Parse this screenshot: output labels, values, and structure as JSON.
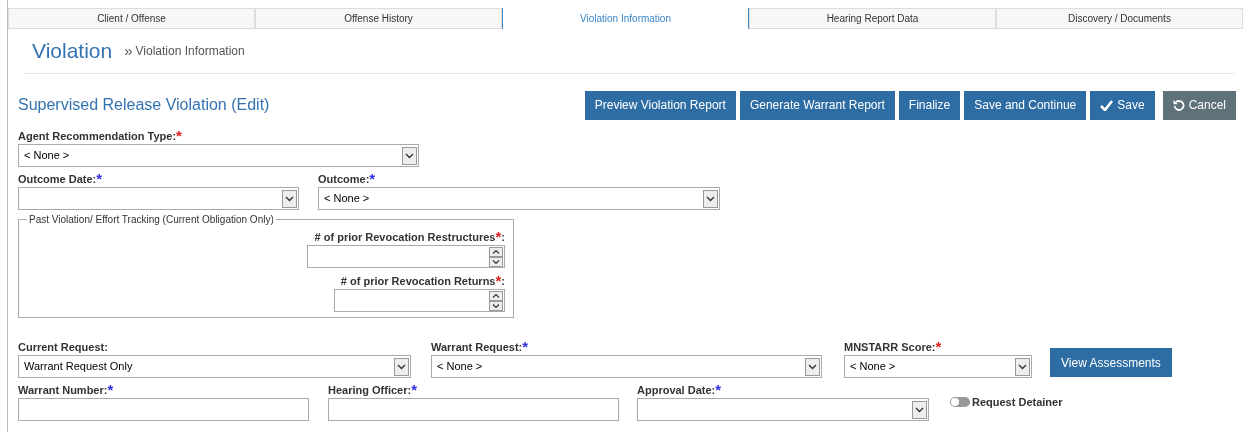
{
  "tabs": [
    {
      "label": "Client / Offense",
      "selected": false
    },
    {
      "label": "Offense History",
      "selected": false
    },
    {
      "label": "Violation Information",
      "selected": true
    },
    {
      "label": "Hearing Report Data",
      "selected": false
    },
    {
      "label": "Discovery / Documents",
      "selected": false
    }
  ],
  "header": {
    "title": "Violation",
    "breadcrumb_separator": "»",
    "breadcrumb": "Violation Information"
  },
  "form_title": "Supervised Release Violation (Edit)",
  "buttons": [
    {
      "label": "Preview Violation Report",
      "kind": "primary"
    },
    {
      "label": "Generate Warrant Report",
      "kind": "primary"
    },
    {
      "label": "Finalize",
      "kind": "primary"
    },
    {
      "label": "Save and Continue",
      "kind": "primary"
    },
    {
      "label": "Save",
      "kind": "save"
    },
    {
      "label": "Cancel",
      "kind": "cancel"
    }
  ],
  "agent_recommendation": {
    "label": "Agent Recommendation Type:",
    "required_mark": "*",
    "color": "#e02020",
    "value": "< None >"
  },
  "outcome_date": {
    "label": "Outcome Date:",
    "required_mark": "*",
    "color": "#3030e0"
  },
  "outcome": {
    "label": "Outcome:",
    "required_mark": "*",
    "color": "#3030e0",
    "value": "< None >"
  },
  "tracking": {
    "legend": "Past Violation/ Effort Tracking (Current Obligation Only)",
    "fields": [
      {
        "label": "# of prior Revocation Restructures",
        "required_mark": "*",
        "color": "#e02020",
        "suffix": ":"
      },
      {
        "label": "# of prior Revocation Returns",
        "required_mark": "*",
        "color": "#e02020",
        "suffix": ":"
      }
    ]
  },
  "current_request": {
    "label": "Current Request:",
    "value": "Warrant Request Only"
  },
  "warrant_request": {
    "label": "Warrant Request:",
    "required_mark": "*",
    "color": "#3030e0",
    "value": "< None >"
  },
  "mnstarr_score": {
    "label": "MNSTARR Score:",
    "required_mark": "*",
    "color": "#e02020",
    "value": "< None >"
  },
  "view_assessments": "View Assessments",
  "warrant_number": {
    "label": "Warrant Number:",
    "required_mark": "*",
    "color": "#3030e0"
  },
  "hearing_officer": {
    "label": "Hearing Officer:",
    "required_mark": "*",
    "color": "#3030e0"
  },
  "approval_date": {
    "label": "Approval Date:",
    "required_mark": "*",
    "color": "#3030e0"
  },
  "request_detainer": {
    "label": "Request Detainer",
    "on": false
  }
}
